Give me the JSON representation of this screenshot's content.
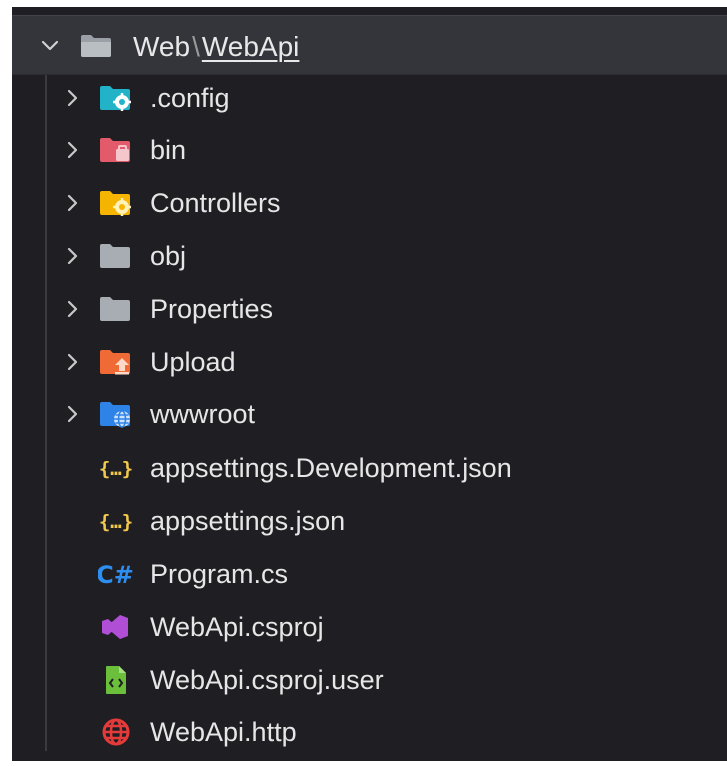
{
  "explorer": {
    "breadcrumb": {
      "parent": "Web",
      "separator": "\\",
      "current": "WebApi"
    },
    "items": [
      {
        "label": ".config",
        "type": "folder",
        "icon": "config-folder-icon",
        "color": "#23b3c8"
      },
      {
        "label": "bin",
        "type": "folder",
        "icon": "bin-folder-icon",
        "color": "#e35a6a"
      },
      {
        "label": "Controllers",
        "type": "folder",
        "icon": "controllers-folder-icon",
        "color": "#f5b400"
      },
      {
        "label": "obj",
        "type": "folder",
        "icon": "obj-folder-icon",
        "color": "#a7adb3"
      },
      {
        "label": "Properties",
        "type": "folder",
        "icon": "properties-folder-icon",
        "color": "#a7adb3"
      },
      {
        "label": "Upload",
        "type": "folder",
        "icon": "upload-folder-icon",
        "color": "#f06a35"
      },
      {
        "label": "wwwroot",
        "type": "folder",
        "icon": "wwwroot-folder-icon",
        "color": "#2e83e6"
      },
      {
        "label": "appsettings.Development.json",
        "type": "file",
        "icon": "json-file-icon",
        "color": "#f2c94c"
      },
      {
        "label": "appsettings.json",
        "type": "file",
        "icon": "json-file-icon",
        "color": "#f2c94c"
      },
      {
        "label": "Program.cs",
        "type": "file",
        "icon": "csharp-file-icon",
        "color": "#2d8ef0"
      },
      {
        "label": "WebApi.csproj",
        "type": "file",
        "icon": "visual-studio-project-icon",
        "color": "#b04fd6"
      },
      {
        "label": "WebApi.csproj.user",
        "type": "file",
        "icon": "xml-user-file-icon",
        "color": "#6bbf3a"
      },
      {
        "label": "WebApi.http",
        "type": "file",
        "icon": "http-file-icon",
        "color": "#e53a3a"
      }
    ]
  }
}
